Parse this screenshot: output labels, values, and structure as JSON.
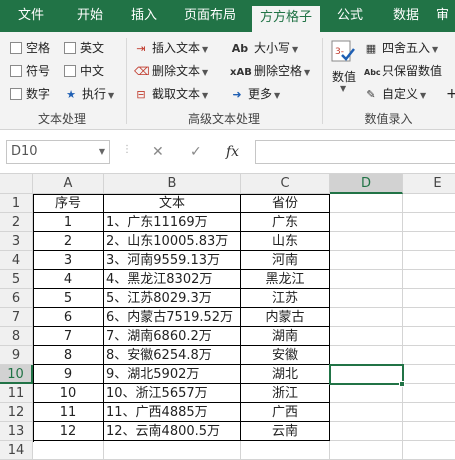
{
  "ribbon_tabs": [
    "文件",
    "开始",
    "插入",
    "页面布局",
    "方方格子",
    "公式",
    "数据",
    "审"
  ],
  "active_tab_index": 4,
  "groups": {
    "text_processing": {
      "label": "文本处理",
      "items": [
        "空格",
        "英文",
        "符号",
        "中文",
        "数字",
        "执行"
      ]
    },
    "advanced_text": {
      "label": "高级文本处理",
      "items": [
        "插入文本",
        "大小写",
        "删除文本",
        "删除空格",
        "截取文本",
        "更多"
      ]
    },
    "number_entry": {
      "label": "数值录入",
      "items": [
        "数值",
        "四舍五入",
        "只保留数值",
        "自定义"
      ]
    }
  },
  "formula_bar": {
    "name_box": "D10",
    "cancel": "✕",
    "enter": "✓",
    "fx": "fx",
    "formula": ""
  },
  "columns": [
    "A",
    "B",
    "C",
    "D",
    "E"
  ],
  "rows": [
    "1",
    "2",
    "3",
    "4",
    "5",
    "6",
    "7",
    "8",
    "9",
    "10",
    "11",
    "12",
    "13",
    "14"
  ],
  "table": {
    "header": [
      "序号",
      "文本",
      "省份"
    ],
    "rows": [
      [
        "1",
        "1、广东11169万",
        "广东"
      ],
      [
        "2",
        "2、山东10005.83万",
        "山东"
      ],
      [
        "3",
        "3、河南9559.13万",
        "河南"
      ],
      [
        "4",
        "4、黑龙江8302万",
        "黑龙江"
      ],
      [
        "5",
        "5、江苏8029.3万",
        "江苏"
      ],
      [
        "6",
        "6、内蒙古7519.52万",
        "内蒙古"
      ],
      [
        "7",
        "7、湖南6860.2万",
        "湖南"
      ],
      [
        "8",
        "8、安徽6254.8万",
        "安徽"
      ],
      [
        "9",
        "9、湖北5902万",
        "湖北"
      ],
      [
        "10",
        "10、浙江5657万",
        "浙江"
      ],
      [
        "11",
        "11、广西4885万",
        "广西"
      ],
      [
        "12",
        "12、云南4800.5万",
        "云南"
      ]
    ]
  },
  "selected_cell": "D10",
  "colors": {
    "brand": "#217346",
    "ribbon": "#f3f3f3"
  }
}
